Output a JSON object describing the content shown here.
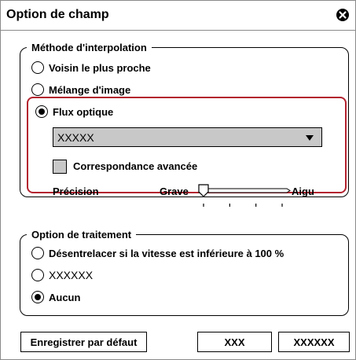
{
  "dialog": {
    "title": "Option de champ",
    "close_icon": "close-icon"
  },
  "interpolation": {
    "legend": "Méthode d'interpolation",
    "options": [
      {
        "label": "Voisin le plus proche",
        "selected": false
      },
      {
        "label": "Mélange d'image",
        "selected": false
      },
      {
        "label": "Flux optique",
        "selected": true
      }
    ],
    "select_value": "XXXXX",
    "checkbox_label": "Correspondance avancée",
    "checkbox_checked": false,
    "precision_label": "Précision",
    "slider_min_label": "Grave",
    "slider_max_label": "Aigu",
    "slider_ticks": 4,
    "slider_value_fraction": 0.0
  },
  "processing": {
    "legend": "Option de traitement",
    "options": [
      {
        "label": "Désentrelacer si la vitesse est inférieure à 100 %",
        "selected": false
      },
      {
        "label": "XXXXXX",
        "selected": false
      },
      {
        "label": "Aucun",
        "selected": true
      }
    ]
  },
  "buttons": {
    "save_default": "Enregistrer par défaut",
    "xxx": "XXX",
    "xxxxxx": "XXXXXX"
  },
  "colors": {
    "highlight": "#b3222f",
    "control_gray": "#c8c8c8"
  }
}
